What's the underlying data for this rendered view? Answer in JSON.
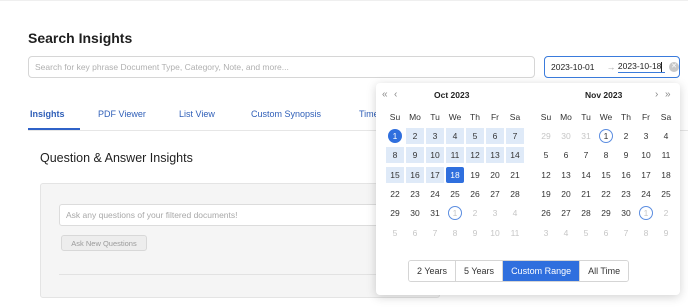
{
  "page": {
    "title": "Search Insights"
  },
  "search": {
    "placeholder": "Search for key phrase Document Type, Category, Note, and more..."
  },
  "date_range": {
    "start": "2023-10-01",
    "arrow": "→",
    "end": "2023-10-18"
  },
  "tabs": [
    "Insights",
    "PDF Viewer",
    "List View",
    "Custom Synopsis",
    "Time"
  ],
  "section_title": "Question & Answer Insights",
  "qa": {
    "placeholder": "Ask any questions of your filtered documents!",
    "ask_button": "Ask New Questions"
  },
  "calendar": {
    "nav_prev_year": "«",
    "nav_prev_month": "‹",
    "nav_next_month": "›",
    "nav_next_year": "»",
    "weekdays": [
      "Su",
      "Mo",
      "Tu",
      "We",
      "Th",
      "Fr",
      "Sa"
    ],
    "left": {
      "header": "Oct  2023",
      "rows": [
        [
          "1",
          "2",
          "3",
          "4",
          "5",
          "6",
          "7"
        ],
        [
          "8",
          "9",
          "10",
          "11",
          "12",
          "13",
          "14"
        ],
        [
          "15",
          "16",
          "17",
          "18",
          "19",
          "20",
          "21"
        ],
        [
          "22",
          "23",
          "24",
          "25",
          "26",
          "27",
          "28"
        ],
        [
          "29",
          "30",
          "31",
          "1",
          "2",
          "3",
          "4"
        ],
        [
          "5",
          "6",
          "7",
          "8",
          "9",
          "10",
          "11"
        ]
      ]
    },
    "right": {
      "header": "Nov  2023",
      "rows": [
        [
          "29",
          "30",
          "31",
          "1",
          "2",
          "3",
          "4"
        ],
        [
          "5",
          "6",
          "7",
          "8",
          "9",
          "10",
          "11"
        ],
        [
          "12",
          "13",
          "14",
          "15",
          "16",
          "17",
          "18"
        ],
        [
          "19",
          "20",
          "21",
          "22",
          "23",
          "24",
          "25"
        ],
        [
          "26",
          "27",
          "28",
          "29",
          "30",
          "1",
          "2"
        ],
        [
          "3",
          "4",
          "5",
          "6",
          "7",
          "8",
          "9"
        ]
      ]
    },
    "presets": [
      "2 Years",
      "5 Years",
      "Custom Range",
      "All Time"
    ],
    "active_preset": "Custom Range"
  },
  "colors": {
    "accent": "#2f6fde",
    "range": "#dfeaf8",
    "link": "#2f5fb8"
  }
}
